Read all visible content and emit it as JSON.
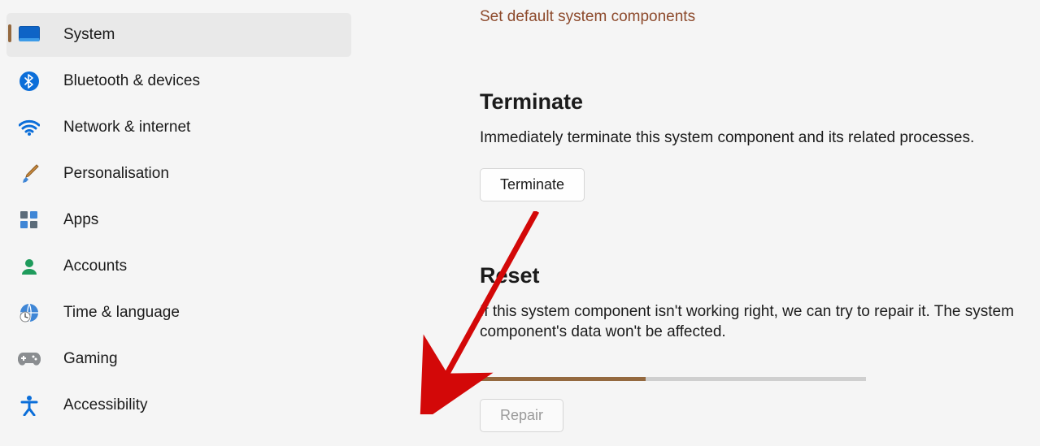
{
  "sidebar": {
    "items": [
      {
        "label": "System",
        "icon": "system-icon",
        "active": true
      },
      {
        "label": "Bluetooth & devices",
        "icon": "bluetooth-icon",
        "active": false
      },
      {
        "label": "Network & internet",
        "icon": "wifi-icon",
        "active": false
      },
      {
        "label": "Personalisation",
        "icon": "paintbrush-icon",
        "active": false
      },
      {
        "label": "Apps",
        "icon": "apps-icon",
        "active": false
      },
      {
        "label": "Accounts",
        "icon": "accounts-icon",
        "active": false
      },
      {
        "label": "Time & language",
        "icon": "time-language-icon",
        "active": false
      },
      {
        "label": "Gaming",
        "icon": "gaming-icon",
        "active": false
      },
      {
        "label": "Accessibility",
        "icon": "accessibility-icon",
        "active": false
      }
    ]
  },
  "main": {
    "top_link": "Set default system components",
    "terminate": {
      "title": "Terminate",
      "desc": "Immediately terminate this system component and its related processes.",
      "button": "Terminate"
    },
    "reset": {
      "title": "Reset",
      "desc": "If this system component isn't working right, we can try to repair it. The system component's data won't be affected.",
      "button": "Repair",
      "progress_percent": 43
    }
  },
  "annotation": {
    "arrow_color": "#d30808"
  }
}
